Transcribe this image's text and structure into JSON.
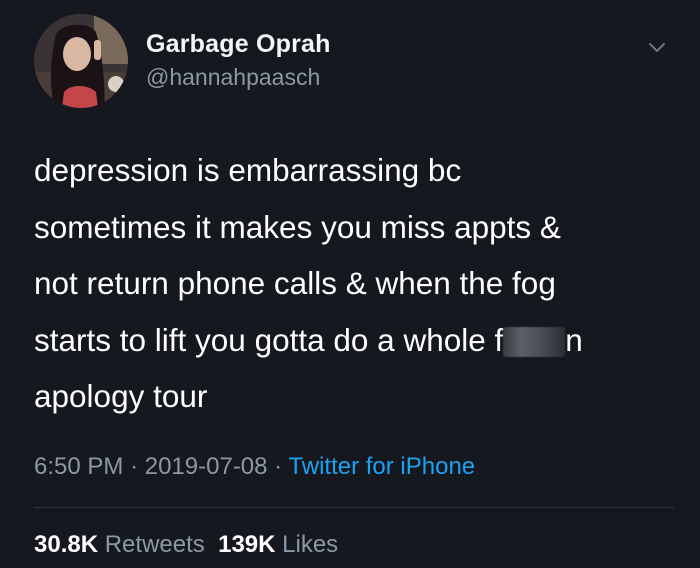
{
  "tweet": {
    "author": {
      "display_name": "Garbage Oprah",
      "handle": "@hannahpaasch"
    },
    "text_lines": [
      "depression is embarrassing bc",
      "sometimes it makes you miss appts &",
      "not return phone calls & when the fog",
      "starts to lift you gotta do a whole f",
      "apology tour"
    ],
    "censored_word_tail": "n",
    "time": "6:50 PM",
    "date": "2019-07-08",
    "separator": "·",
    "source": "Twitter for iPhone",
    "retweets_count": "30.8K",
    "retweets_label": "Retweets",
    "likes_count": "139K",
    "likes_label": "Likes"
  },
  "colors": {
    "background": "#15181e",
    "primary_text": "#ffffff",
    "secondary_text": "#8b98a5",
    "link": "#1da1f2"
  },
  "icons": {
    "menu": "chevron-down-icon"
  }
}
